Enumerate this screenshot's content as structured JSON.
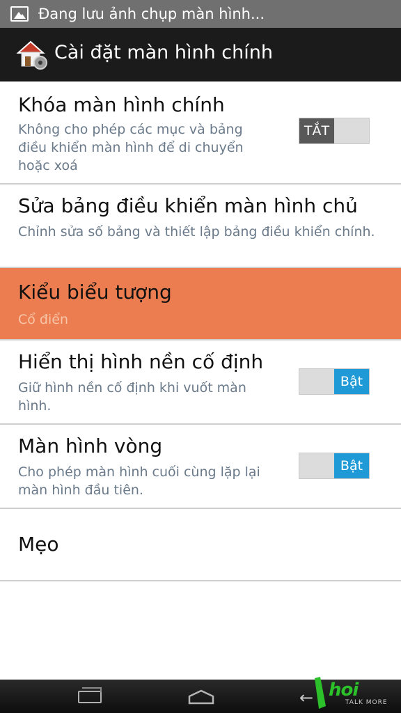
{
  "status_bar": {
    "notification_icon": "image-icon",
    "text": "Đang lưu ảnh chụp màn hình..."
  },
  "action_bar": {
    "icon": "home-settings-icon",
    "title": "Cài đặt màn hình chính"
  },
  "settings": [
    {
      "title": "Khóa màn hình chính",
      "subtitle": "Không cho phép các mục và bảng điều khiển màn hình để di chuyển hoặc xoá",
      "toggle": {
        "state": "off",
        "label": "TẮT"
      }
    },
    {
      "title": "Sửa bảng điều khiển màn hình chủ",
      "subtitle": "Chỉnh sửa số bảng và thiết lập bảng điều khiển chính."
    },
    {
      "title": "Kiểu biểu tượng",
      "subtitle": "Cổ điển",
      "selected": true
    },
    {
      "title": "Hiển thị hình nền cố định",
      "subtitle": "Giữ hình nền cố định khi vuốt màn hình.",
      "toggle": {
        "state": "on",
        "label": "Bật"
      }
    },
    {
      "title": "Màn hình vòng",
      "subtitle": "Cho phép màn hình cuối cùng lặp lại màn hình đầu tiên.",
      "toggle": {
        "state": "on",
        "label": "Bật"
      }
    },
    {
      "title": "Mẹo"
    }
  ],
  "navigation": {
    "recent_icon": "recent-apps-icon",
    "home_icon": "home-icon",
    "back_icon": "back-icon"
  },
  "watermark": {
    "text": "hoi",
    "tagline": "TALK MORE"
  },
  "colors": {
    "selected_row": "#ec7d50",
    "toggle_on": "#1f9ad6",
    "toggle_off": "#585858"
  }
}
